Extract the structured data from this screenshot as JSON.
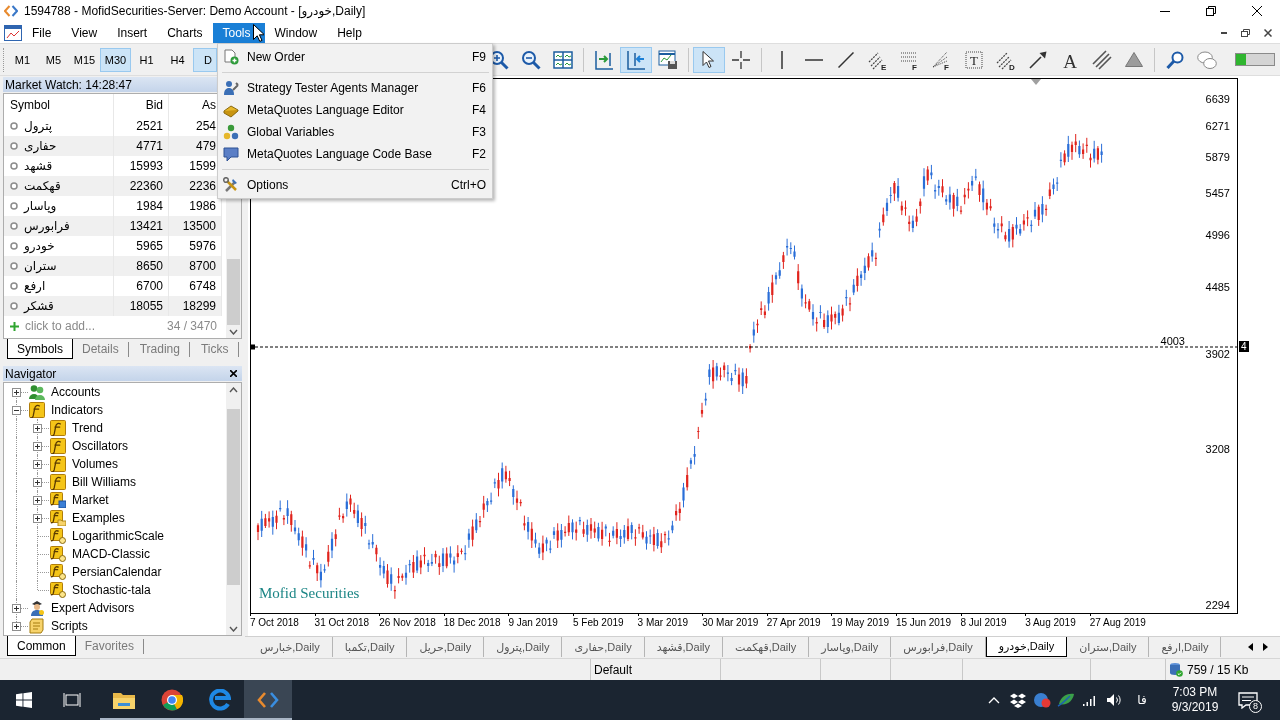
{
  "window": {
    "title": "1594788 - MofidSecurities-Server: Demo Account - [خودرو,Daily]"
  },
  "menu": [
    {
      "label": "File",
      "selected": false
    },
    {
      "label": "View",
      "selected": false
    },
    {
      "label": "Insert",
      "selected": false
    },
    {
      "label": "Charts",
      "selected": false
    },
    {
      "label": "Tools",
      "selected": true
    },
    {
      "label": "Window",
      "selected": false
    },
    {
      "label": "Help",
      "selected": false
    }
  ],
  "tools_menu": [
    {
      "kind": "order",
      "label": "New Order",
      "shortcut": "F9"
    },
    {
      "kind": "separator"
    },
    {
      "kind": "agents",
      "label": "Strategy Tester Agents Manager",
      "shortcut": "F6"
    },
    {
      "kind": "editor",
      "label": "MetaQuotes Language Editor",
      "shortcut": "F4"
    },
    {
      "kind": "variables",
      "label": "Global Variables",
      "shortcut": "F3"
    },
    {
      "kind": "codebase",
      "label": "MetaQuotes Language Code Base",
      "shortcut": "F2"
    },
    {
      "kind": "separator"
    },
    {
      "kind": "options",
      "label": "Options",
      "shortcut": "Ctrl+O"
    }
  ],
  "timeframes": [
    {
      "label": "M1",
      "selected": false
    },
    {
      "label": "M5",
      "selected": false
    },
    {
      "label": "M15",
      "selected": false
    },
    {
      "label": "M30",
      "selected": true
    },
    {
      "label": "H1",
      "selected": false
    },
    {
      "label": "H4",
      "selected": false
    },
    {
      "label": "D",
      "selected": true
    }
  ],
  "toolbar_groups": [
    [
      {
        "kind": "zoom-in",
        "selected": false
      },
      {
        "kind": "zoom-out",
        "selected": false
      },
      {
        "kind": "tile",
        "selected": false
      }
    ],
    [
      {
        "kind": "chart-shift",
        "selected": false
      },
      {
        "kind": "autoscroll",
        "selected": true
      },
      {
        "kind": "templates",
        "selected": false
      }
    ],
    [
      {
        "kind": "cursor",
        "selected": true
      },
      {
        "kind": "crosshair",
        "selected": false
      }
    ],
    [
      {
        "kind": "vertical-line",
        "selected": false
      },
      {
        "kind": "horizontal-line",
        "selected": false
      },
      {
        "kind": "trendline",
        "selected": false
      },
      {
        "kind": "channel",
        "badge": "E",
        "selected": false
      },
      {
        "kind": "fibonacci",
        "badge": "F",
        "selected": false
      },
      {
        "kind": "fan",
        "badge": "F",
        "selected": false
      },
      {
        "kind": "text-label",
        "badge": "T",
        "selected": false
      },
      {
        "kind": "pitchfork",
        "badge": "D",
        "selected": false
      },
      {
        "kind": "arrow",
        "selected": false
      },
      {
        "kind": "text",
        "badge": "A",
        "selected": false
      },
      {
        "kind": "parallel-lines",
        "selected": false
      },
      {
        "kind": "triangle",
        "selected": false
      }
    ],
    [
      {
        "kind": "search",
        "selected": false
      },
      {
        "kind": "chat",
        "selected": false
      }
    ]
  ],
  "market_watch": {
    "title": "Market Watch: 14:28:47",
    "columns": [
      "Symbol",
      "Bid",
      "As"
    ],
    "rows": [
      {
        "symbol": "پترول",
        "bid": "2521",
        "ask": "254"
      },
      {
        "symbol": "حفاری",
        "bid": "4771",
        "ask": "479"
      },
      {
        "symbol": "قشهد",
        "bid": "15993",
        "ask": "1599"
      },
      {
        "symbol": "قهکمت",
        "bid": "22360",
        "ask": "2236"
      },
      {
        "symbol": "وپاسار",
        "bid": "1984",
        "ask": "1986"
      },
      {
        "symbol": "فرابورس",
        "bid": "13421",
        "ask": "13500"
      },
      {
        "symbol": "خودرو",
        "bid": "5965",
        "ask": "5976"
      },
      {
        "symbol": "ستران",
        "bid": "8650",
        "ask": "8700"
      },
      {
        "symbol": "ارفع",
        "bid": "6700",
        "ask": "6748"
      },
      {
        "symbol": "قشکر",
        "bid": "18055",
        "ask": "18299"
      }
    ],
    "add_row": {
      "label": "click to add...",
      "count": "34 / 3470"
    },
    "tabs": [
      {
        "label": "Symbols",
        "selected": true
      },
      {
        "label": "Details",
        "selected": false
      },
      {
        "label": "Trading",
        "selected": false
      },
      {
        "label": "Ticks",
        "selected": false
      }
    ]
  },
  "navigator": {
    "title": "Navigator",
    "tree": [
      {
        "label": "Accounts",
        "kind": "accounts",
        "expanded": false
      },
      {
        "label": "Indicators",
        "kind": "group",
        "expanded": true,
        "children": [
          {
            "label": "Trend",
            "kind": "group",
            "expanded": false
          },
          {
            "label": "Oscillators",
            "kind": "group",
            "expanded": false
          },
          {
            "label": "Volumes",
            "kind": "group",
            "expanded": false
          },
          {
            "label": "Bill Williams",
            "kind": "group",
            "expanded": false
          },
          {
            "label": "Market",
            "kind": "market",
            "expanded": false
          },
          {
            "label": "Examples",
            "kind": "examples",
            "expanded": false
          },
          {
            "label": "LogarithmicScale",
            "kind": "indicator"
          },
          {
            "label": "MACD-Classic",
            "kind": "indicator"
          },
          {
            "label": "PersianCalendar",
            "kind": "indicator"
          },
          {
            "label": "Stochastic-tala",
            "kind": "indicator"
          }
        ]
      },
      {
        "label": "Expert Advisors",
        "kind": "experts",
        "expanded": false
      },
      {
        "label": "Scripts",
        "kind": "scripts",
        "expanded": false
      }
    ],
    "tabs": [
      {
        "label": "Common",
        "selected": true
      },
      {
        "label": "Favorites",
        "selected": false
      }
    ]
  },
  "chart": {
    "broker_label": "Mofid Securities",
    "price_axis": [
      "6639",
      "6271",
      "5879",
      "5457",
      "4996",
      "4485",
      "3902",
      "3208",
      "2294"
    ],
    "line_label": "4003",
    "price_tag": "4",
    "time_axis": [
      "7 Oct 2018",
      "31 Oct 2018",
      "26 Nov 2018",
      "18 Dec 2018",
      "9 Jan 2019",
      "5 Feb 2019",
      "3 Mar 2019",
      "30 Mar 2019",
      "27 Apr 2019",
      "19 May 2019",
      "15 Jun 2019",
      "8 Jul 2019",
      "3 Aug 2019",
      "27 Aug 2019"
    ]
  },
  "chart_tabs": [
    {
      "label": "خبارس,Daily",
      "selected": false
    },
    {
      "label": "تکمبا,Daily",
      "selected": false
    },
    {
      "label": "حریل,Daily",
      "selected": false
    },
    {
      "label": "پترول,Daily",
      "selected": false
    },
    {
      "label": "حفاری,Daily",
      "selected": false
    },
    {
      "label": "قشهد,Daily",
      "selected": false
    },
    {
      "label": "قهکمت,Daily",
      "selected": false
    },
    {
      "label": "وپاسار,Daily",
      "selected": false
    },
    {
      "label": "فرابورس,Daily",
      "selected": false
    },
    {
      "label": "خودرو,Daily",
      "selected": true
    },
    {
      "label": "ستران,Daily",
      "selected": false
    },
    {
      "label": "ارفع,Daily",
      "selected": false
    }
  ],
  "status_bar": {
    "profile": "Default",
    "traffic": "759 / 15 Kb"
  },
  "taskbar": {
    "apps": [
      {
        "kind": "start",
        "running": false,
        "selected": false
      },
      {
        "kind": "task-view",
        "running": false,
        "selected": false
      },
      {
        "kind": "folder",
        "running": true,
        "selected": false
      },
      {
        "kind": "round-browser",
        "running": true,
        "selected": false
      },
      {
        "kind": "e-browser",
        "running": true,
        "selected": false
      },
      {
        "kind": "terminal",
        "running": true,
        "selected": true
      }
    ],
    "tray": [
      {
        "kind": "chevron"
      },
      {
        "kind": "box"
      },
      {
        "kind": "badge-app"
      },
      {
        "kind": "leaf-app"
      },
      {
        "kind": "network"
      },
      {
        "kind": "volume"
      }
    ],
    "language": "فا",
    "time": "7:03 PM",
    "date": "9/3/2019",
    "notifications": "8"
  }
}
